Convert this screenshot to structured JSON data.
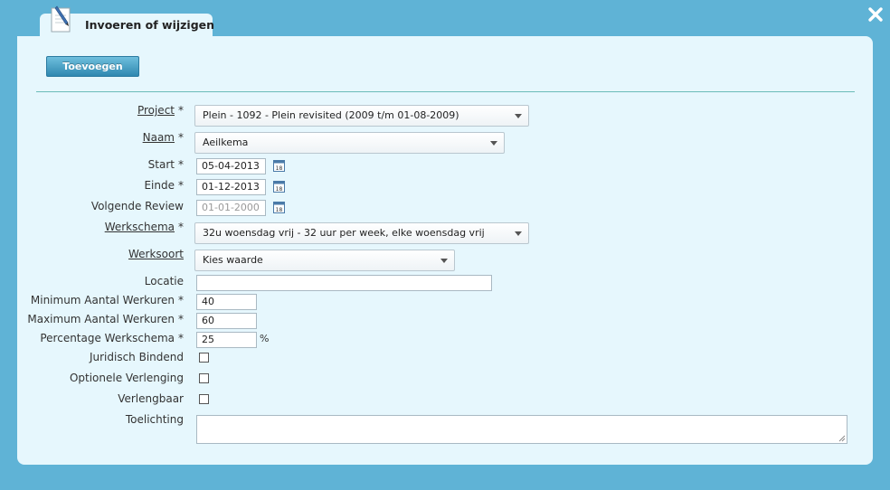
{
  "window": {
    "tab_title": "Invoeren of wijzigen",
    "add_button": "Toevoegen"
  },
  "form": {
    "project": {
      "label": "Project",
      "required": "*",
      "value": "Plein - 1092 - Plein revisited (2009 t/m 01-08-2009)"
    },
    "naam": {
      "label": "Naam",
      "required": "*",
      "value": "Aeilkema"
    },
    "start": {
      "label": "Start",
      "required": "*",
      "value": "05-04-2013"
    },
    "einde": {
      "label": "Einde",
      "required": "*",
      "value": "01-12-2013"
    },
    "volgende_review": {
      "label": "Volgende Review",
      "placeholder": "01-01-2000"
    },
    "werkschema": {
      "label": "Werkschema",
      "required": "*",
      "value": "32u woensdag vrij - 32 uur per week, elke woensdag vrij"
    },
    "werksoort": {
      "label": "Werksoort",
      "value": "Kies waarde"
    },
    "locatie": {
      "label": "Locatie",
      "value": ""
    },
    "min_werkuren": {
      "label": "Minimum Aantal Werkuren",
      "required": "*",
      "value": "40"
    },
    "max_werkuren": {
      "label": "Maximum Aantal Werkuren",
      "required": "*",
      "value": "60"
    },
    "percentage": {
      "label": "Percentage Werkschema",
      "required": "*",
      "value": "25",
      "unit": "%"
    },
    "juridisch_bindend": {
      "label": "Juridisch Bindend",
      "checked": false
    },
    "optionele_verlenging": {
      "label": "Optionele Verlenging",
      "checked": false
    },
    "verlengbaar": {
      "label": "Verlengbaar",
      "checked": false
    },
    "toelichting": {
      "label": "Toelichting",
      "value": ""
    }
  },
  "colors": {
    "background": "#5fb3d6",
    "panel": "#e6f7fd",
    "button": "#3a94bc",
    "divider": "#6bbcb9"
  }
}
